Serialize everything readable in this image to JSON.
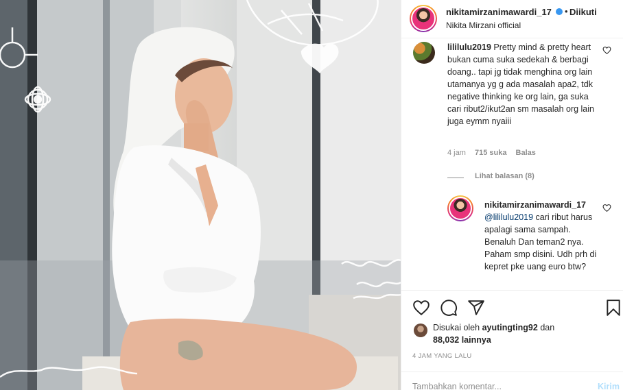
{
  "post": {
    "image_alt": "Woman wearing a white towel on her head and a white shirt, sitting by a window with doodle decorations"
  },
  "header": {
    "username": "nikitamirzanimawardi_17",
    "dot": "•",
    "follow_label": "Diikuti",
    "subtitle": "Nikita Mirzani official",
    "avatar_icon": "profile-avatar"
  },
  "comments": [
    {
      "username": "lililulu2019",
      "text": "Pretty mind & pretty heart bukan cuma suka sedekah & berbagi doang.. tapi jg tidak menghina org lain utamanya yg g ada masalah apa2, tdk negative thinking ke org lain, ga suka cari ribut2/ikut2an sm masalah org lain juga eymm nyaiii",
      "time": "4 jam",
      "likes": "715 suka",
      "reply_label": "Balas",
      "view_replies": "Lihat balasan (8)"
    }
  ],
  "reply": {
    "username": "nikitamirzanimawardi_17",
    "mention": "@lililulu2019",
    "text": " cari ribut harus apalagi sama sampah. Benaluh Dan teman2 nya. Paham smp disini. Udh prh di kepret pke uang euro btw?"
  },
  "actions": {
    "like_icon": "heart-icon",
    "comment_icon": "comment-icon",
    "share_icon": "send-icon",
    "save_icon": "bookmark-icon"
  },
  "likes": {
    "prefix": "Disukai oleh ",
    "user": "ayutingting92",
    "middle": " dan",
    "count": "88,032 lainnya"
  },
  "time_ago": "4 JAM YANG LALU",
  "add_comment": {
    "placeholder": "Tambahkan komentar...",
    "send_label": "Kirim"
  },
  "colors": {
    "text": "#262626",
    "muted": "#8e8e8e",
    "link": "#00376b",
    "send_disabled": "#b2dffc",
    "verified": "#3897f0"
  }
}
